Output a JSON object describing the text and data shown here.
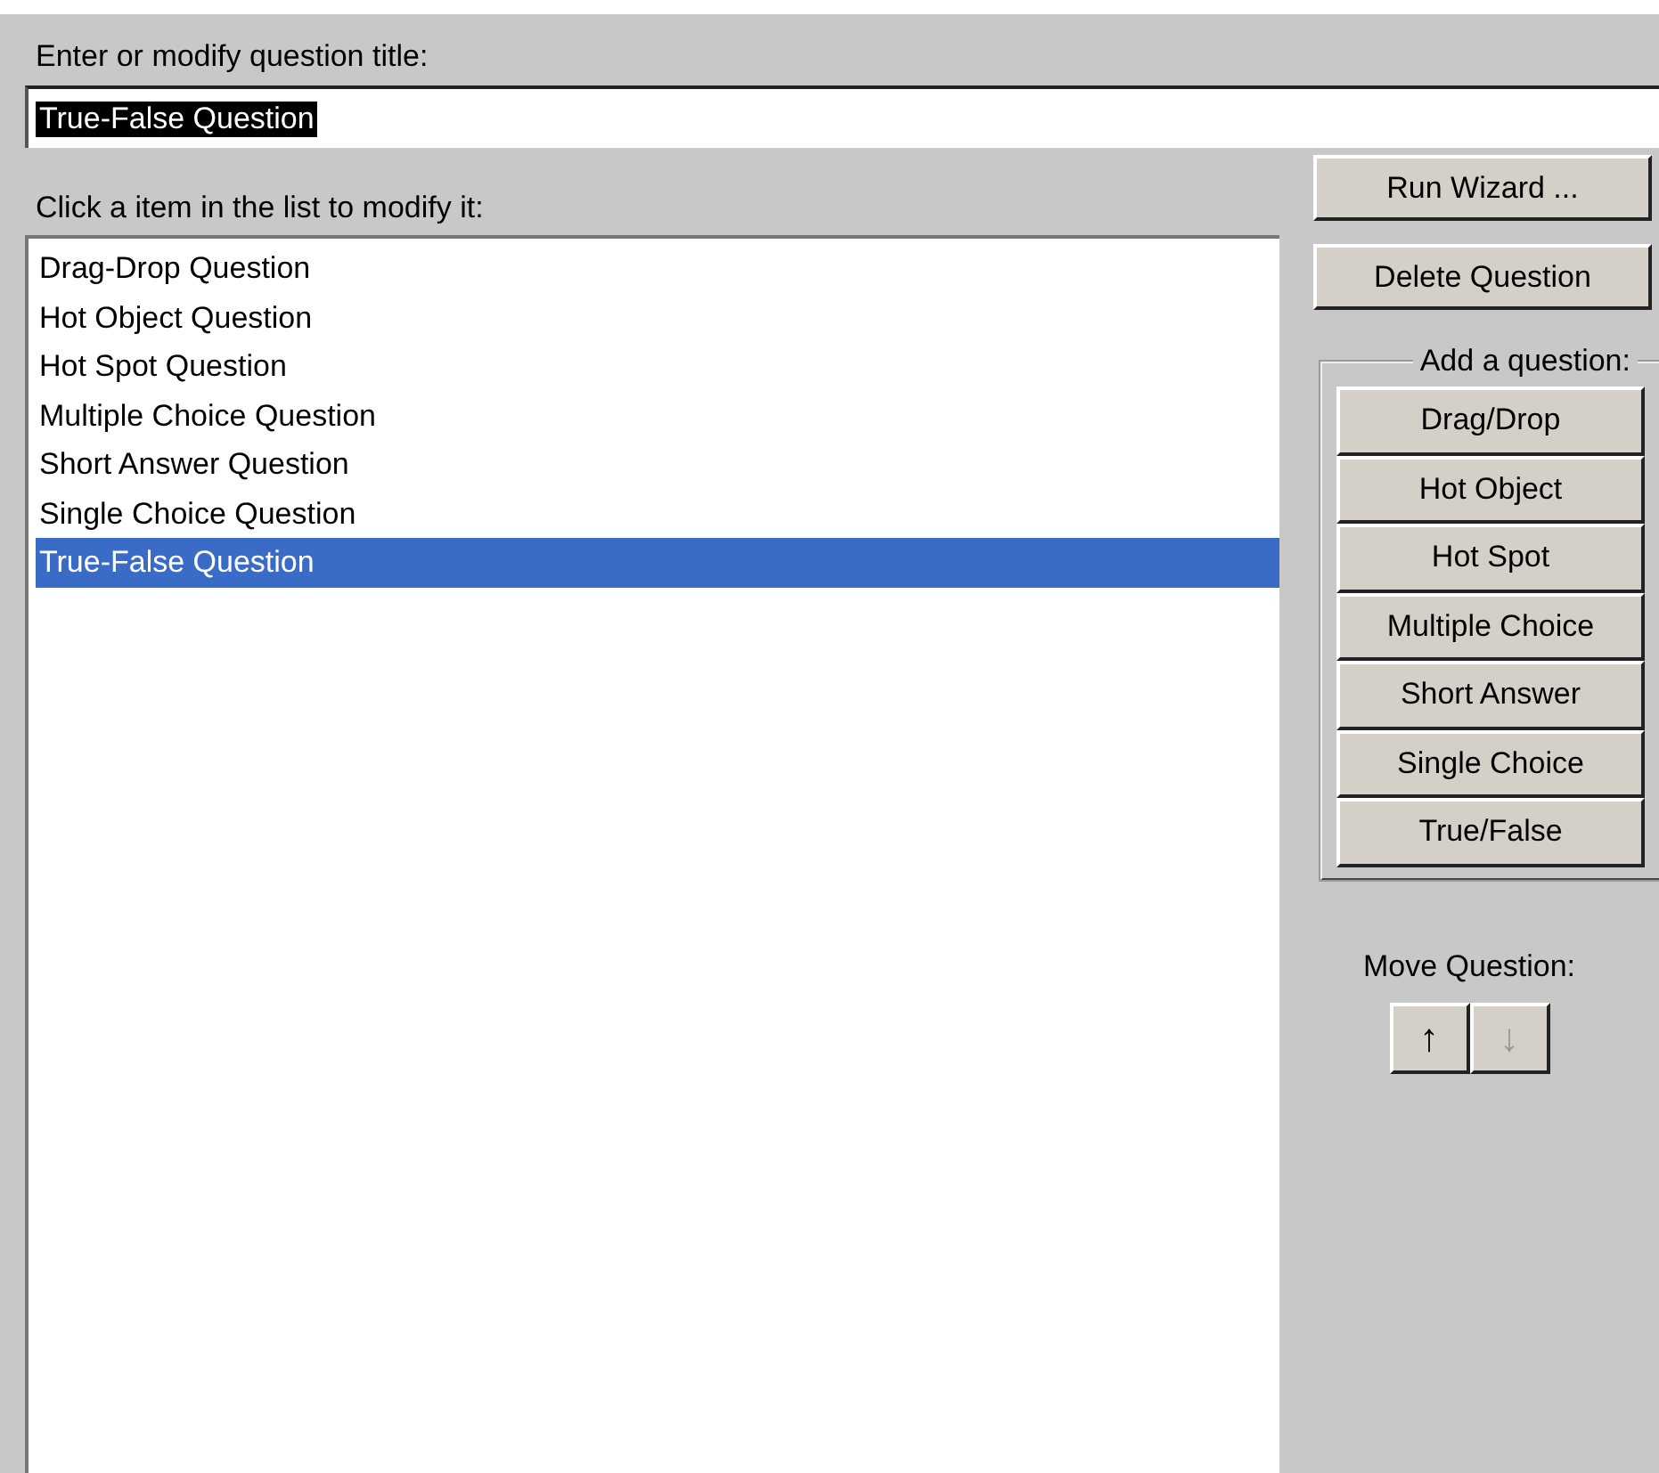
{
  "title_field": {
    "label": "Enter or modify question title:",
    "value": "True-False Question",
    "text_selected": true
  },
  "question_list": {
    "label": "Click a item in the list to modify it:",
    "items": [
      {
        "text": "Drag-Drop Question",
        "selected": false
      },
      {
        "text": "Hot Object Question",
        "selected": false
      },
      {
        "text": "Hot Spot Question",
        "selected": false
      },
      {
        "text": "Multiple Choice Question",
        "selected": false
      },
      {
        "text": "Short Answer Question",
        "selected": false
      },
      {
        "text": "Single Choice Question",
        "selected": false
      },
      {
        "text": "True-False Question",
        "selected": true
      }
    ]
  },
  "actions": [
    "Run Wizard ...",
    "Delete Question"
  ],
  "add_group": {
    "title": "Add a question:",
    "buttons": [
      "Drag/Drop",
      "Hot Object",
      "Hot Spot",
      "Multiple Choice",
      "Short Answer",
      "Single Choice",
      "True/False"
    ]
  },
  "move": {
    "label": "Move Question:",
    "buttons": [
      {
        "text": "↑",
        "disabled": false
      },
      {
        "text": "↓",
        "disabled": true
      }
    ]
  }
}
